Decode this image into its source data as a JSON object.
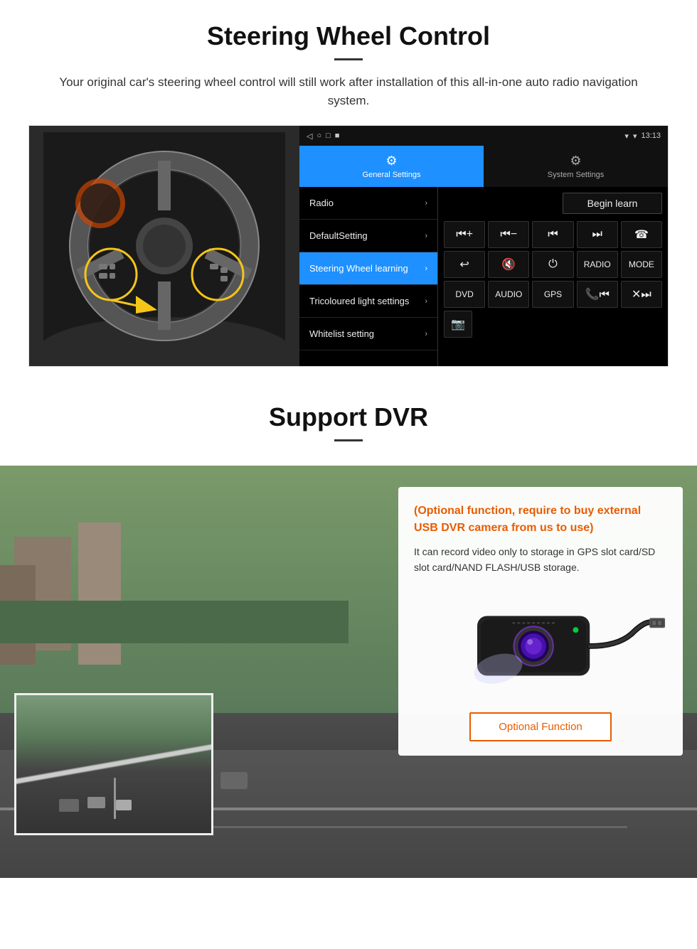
{
  "steering_section": {
    "title": "Steering Wheel Control",
    "description": "Your original car's steering wheel control will still work after installation of this all-in-one auto radio navigation system.",
    "android_ui": {
      "statusbar": {
        "time": "13:13",
        "signal_icon": "▼",
        "wifi_icon": "▾",
        "battery_icon": "▮"
      },
      "tabs": [
        {
          "label": "General Settings",
          "icon": "⚙",
          "active": true
        },
        {
          "label": "System Settings",
          "icon": "⚙",
          "active": false
        }
      ],
      "menu_items": [
        {
          "label": "Radio",
          "active": false
        },
        {
          "label": "DefaultSetting",
          "active": false
        },
        {
          "label": "Steering Wheel learning",
          "active": true
        },
        {
          "label": "Tricoloured light settings",
          "active": false
        },
        {
          "label": "Whitelist setting",
          "active": false
        }
      ],
      "begin_learn": "Begin learn",
      "control_buttons": {
        "row1": [
          "▐+",
          "▐−",
          "⏮",
          "⏭",
          "☎"
        ],
        "row2": [
          "↩",
          "✕×",
          "⏻",
          "RADIO",
          "MODE"
        ],
        "row3": [
          "DVD",
          "AUDIO",
          "GPS",
          "📞⏮",
          "✕⏭"
        ],
        "row4": [
          "📷"
        ]
      }
    }
  },
  "dvr_section": {
    "title": "Support DVR",
    "optional_highlight": "(Optional function, require to buy external USB DVR camera from us to use)",
    "description": "It can record video only to storage in GPS slot card/SD slot card/NAND FLASH/USB storage.",
    "optional_button_label": "Optional Function"
  }
}
